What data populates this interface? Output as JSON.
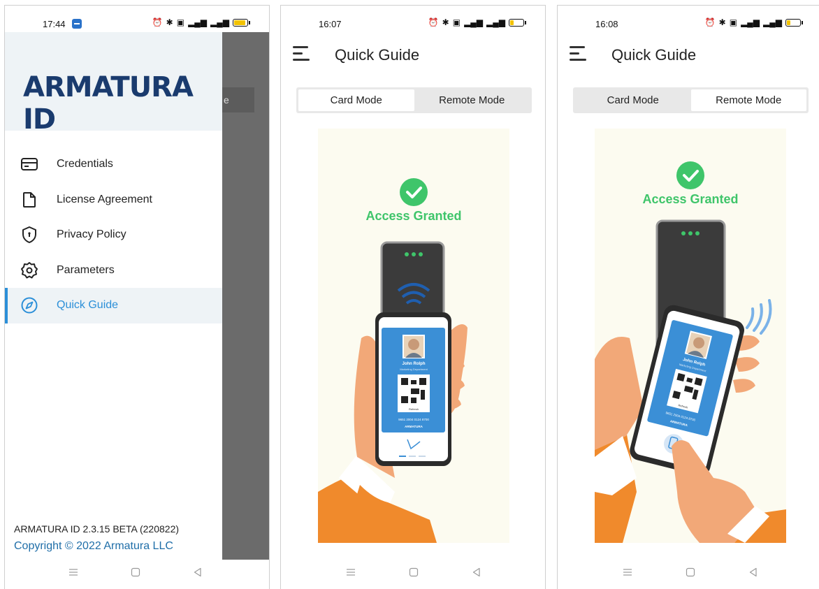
{
  "screens": [
    {
      "status_time": "17:44",
      "drawer": {
        "logo_main": "ARMATURA",
        "logo_id": "ID",
        "items": [
          {
            "label": "Credentials",
            "icon": "card-icon"
          },
          {
            "label": "License Agreement",
            "icon": "document-icon"
          },
          {
            "label": "Privacy Policy",
            "icon": "shield-icon"
          },
          {
            "label": "Parameters",
            "icon": "gear-icon"
          },
          {
            "label": "Quick Guide",
            "icon": "compass-icon",
            "active": true
          }
        ],
        "version": "ARMATURA ID 2.3.15 BETA (220822)",
        "copyright": "Copyright © 2022 Armatura LLC"
      },
      "background_fragment": "e"
    },
    {
      "status_time": "16:07",
      "title": "Quick Guide",
      "tabs": [
        "Card Mode",
        "Remote Mode"
      ],
      "selected_tab": "Card Mode",
      "illustration": {
        "status": "Access Granted",
        "name": "John Rolph",
        "department": "Marketing Department",
        "refresh": "Refresh",
        "card_number": "9651 2004 0124 8700",
        "brand": "ARMATURA"
      }
    },
    {
      "status_time": "16:08",
      "title": "Quick Guide",
      "tabs": [
        "Card Mode",
        "Remote Mode"
      ],
      "selected_tab": "Remote Mode",
      "illustration": {
        "status": "Access Granted",
        "name": "John Rolph",
        "department": "Marketing Department",
        "refresh": "Refresh",
        "card_number": "9651 2004 0124 8700",
        "brand": "ARMATURA"
      }
    }
  ],
  "colors": {
    "accent": "#2b8fd8",
    "granted_green": "#3fc56a",
    "drawer_header": "#eef3f6",
    "logo_navy": "#1a3b6e",
    "logo_orange": "#e45a2a",
    "sleeve_orange": "#f08a2c",
    "skin": "#f2a878"
  }
}
